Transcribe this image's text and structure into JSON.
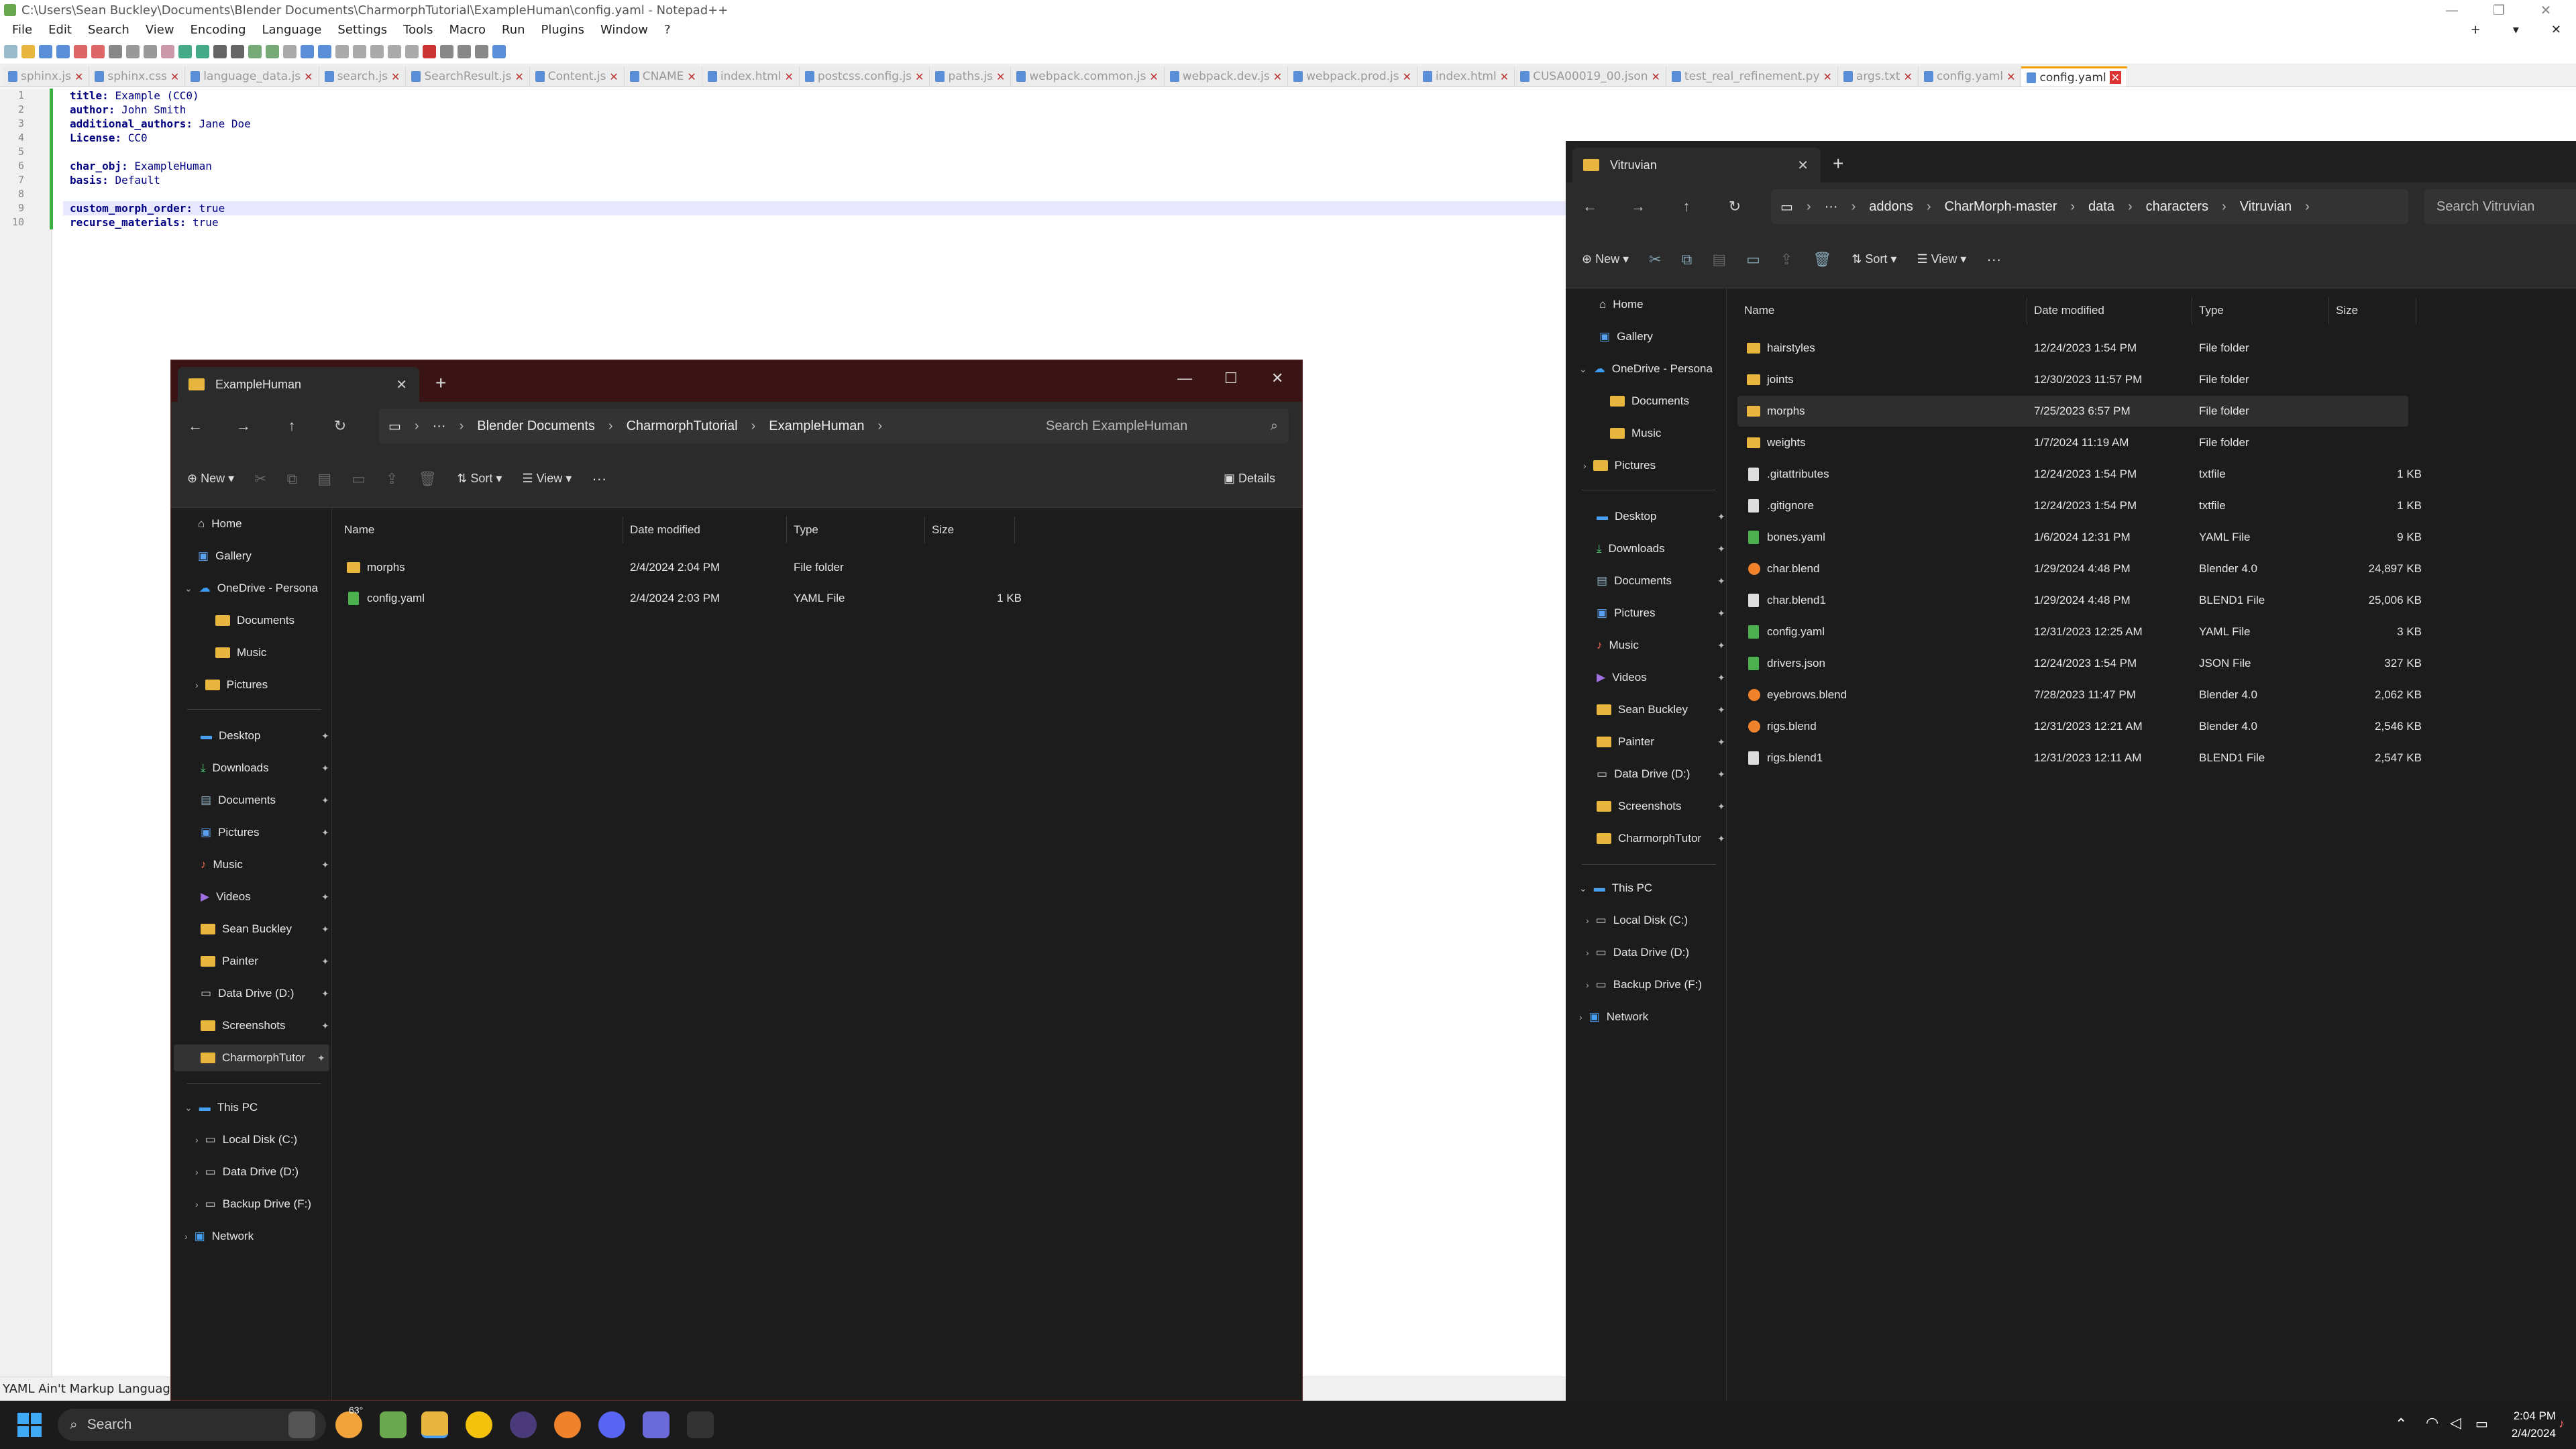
{
  "npp": {
    "title": "C:\\Users\\Sean Buckley\\Documents\\Blender Documents\\CharmorphTutorial\\ExampleHuman\\config.yaml - Notepad++",
    "menu": [
      "File",
      "Edit",
      "Search",
      "View",
      "Encoding",
      "Language",
      "Settings",
      "Tools",
      "Macro",
      "Run",
      "Plugins",
      "Window",
      "?"
    ],
    "menu_right": [
      "+",
      "▾",
      "✕"
    ],
    "tabs": [
      "sphinx.js",
      "sphinx.css",
      "language_data.js",
      "search.js",
      "SearchResult.js",
      "Content.js",
      "CNAME",
      "index.html",
      "postcss.config.js",
      "paths.js",
      "webpack.common.js",
      "webpack.dev.js",
      "webpack.prod.js",
      "index.html",
      "CUSA00019_00.json",
      "test_real_refinement.py",
      "args.txt",
      "config.yaml",
      "config.yaml"
    ],
    "line_numbers": [
      "1",
      "2",
      "3",
      "4",
      "5",
      "6",
      "7",
      "8",
      "9",
      "10"
    ],
    "lines": [
      {
        "key": "title",
        "val": " Example (CC0)"
      },
      {
        "key": "author",
        "val": " John Smith"
      },
      {
        "key": "additional_authors",
        "val": " Jane Doe"
      },
      {
        "key": "License",
        "val": " CC0"
      },
      {
        "key": "",
        "val": ""
      },
      {
        "key": "char_obj",
        "val": " ExampleHuman"
      },
      {
        "key": "basis",
        "val": " Default"
      },
      {
        "key": "",
        "val": ""
      },
      {
        "key": "custom_morph_order",
        "val": " true"
      },
      {
        "key": "recurse_materials",
        "val": " true"
      }
    ],
    "status": "YAML Ain't Markup Language"
  },
  "ex1": {
    "tab_title": "ExampleHuman",
    "breadcrumb": [
      "Blender Documents",
      "CharmorphTutorial",
      "ExampleHuman"
    ],
    "search_placeholder": "Search ExampleHuman",
    "cmd": {
      "new": "New",
      "sort": "Sort",
      "view": "View",
      "more": "···",
      "details": "Details"
    },
    "nav": {
      "top": [
        "Home",
        "Gallery"
      ],
      "onedrive": "OneDrive - Persona",
      "onedrive_items": [
        "Documents",
        "Music",
        "Pictures"
      ],
      "quick": [
        "Desktop",
        "Downloads",
        "Documents",
        "Pictures",
        "Music",
        "Videos",
        "Sean Buckley",
        "Painter",
        "Data Drive (D:)",
        "Screenshots",
        "CharmorphTutor"
      ],
      "pc": "This PC",
      "pc_items": [
        "Local Disk (C:)",
        "Data Drive (D:)",
        "Backup Drive (F:)"
      ],
      "network": "Network"
    },
    "columns": [
      "Name",
      "Date modified",
      "Type",
      "Size"
    ],
    "files": [
      {
        "name": "morphs",
        "date": "2/4/2024 2:04 PM",
        "type": "File folder",
        "size": "",
        "kind": "folder"
      },
      {
        "name": "config.yaml",
        "date": "2/4/2024 2:03 PM",
        "type": "YAML File",
        "size": "1 KB",
        "kind": "yaml"
      }
    ]
  },
  "ex2": {
    "tab_title": "Vitruvian",
    "breadcrumb": [
      "addons",
      "CharMorph-master",
      "data",
      "characters",
      "Vitruvian"
    ],
    "search_placeholder": "Search Vitruvian",
    "cmd": {
      "new": "New",
      "sort": "Sort",
      "view": "View",
      "more": "···"
    },
    "nav": {
      "top": [
        "Home",
        "Gallery"
      ],
      "onedrive": "OneDrive - Persona",
      "onedrive_items": [
        "Documents",
        "Music",
        "Pictures"
      ],
      "quick": [
        "Desktop",
        "Downloads",
        "Documents",
        "Pictures",
        "Music",
        "Videos",
        "Sean Buckley",
        "Painter",
        "Data Drive (D:)",
        "Screenshots",
        "CharmorphTutor"
      ],
      "pc": "This PC",
      "pc_items": [
        "Local Disk (C:)",
        "Data Drive (D:)",
        "Backup Drive (F:)"
      ],
      "network": "Network"
    },
    "columns": [
      "Name",
      "Date modified",
      "Type",
      "Size"
    ],
    "files": [
      {
        "name": "hairstyles",
        "date": "12/24/2023 1:54 PM",
        "type": "File folder",
        "size": "",
        "kind": "folder"
      },
      {
        "name": "joints",
        "date": "12/30/2023 11:57 PM",
        "type": "File folder",
        "size": "",
        "kind": "folder"
      },
      {
        "name": "morphs",
        "date": "7/25/2023 6:57 PM",
        "type": "File folder",
        "size": "",
        "kind": "folder"
      },
      {
        "name": "weights",
        "date": "1/7/2024 11:19 AM",
        "type": "File folder",
        "size": "",
        "kind": "folder"
      },
      {
        "name": ".gitattributes",
        "date": "12/24/2023 1:54 PM",
        "type": "txtfile",
        "size": "1 KB",
        "kind": "txt"
      },
      {
        "name": ".gitignore",
        "date": "12/24/2023 1:54 PM",
        "type": "txtfile",
        "size": "1 KB",
        "kind": "txt"
      },
      {
        "name": "bones.yaml",
        "date": "1/6/2024 12:31 PM",
        "type": "YAML File",
        "size": "9 KB",
        "kind": "yaml"
      },
      {
        "name": "char.blend",
        "date": "1/29/2024 4:48 PM",
        "type": "Blender 4.0",
        "size": "24,897 KB",
        "kind": "blend"
      },
      {
        "name": "char.blend1",
        "date": "1/29/2024 4:48 PM",
        "type": "BLEND1 File",
        "size": "25,006 KB",
        "kind": "txt"
      },
      {
        "name": "config.yaml",
        "date": "12/31/2023 12:25 AM",
        "type": "YAML File",
        "size": "3 KB",
        "kind": "yaml"
      },
      {
        "name": "drivers.json",
        "date": "12/24/2023 1:54 PM",
        "type": "JSON File",
        "size": "327 KB",
        "kind": "yaml"
      },
      {
        "name": "eyebrows.blend",
        "date": "7/28/2023 11:47 PM",
        "type": "Blender 4.0",
        "size": "2,062 KB",
        "kind": "blend"
      },
      {
        "name": "rigs.blend",
        "date": "12/31/2023 12:21 AM",
        "type": "Blender 4.0",
        "size": "2,546 KB",
        "kind": "blend"
      },
      {
        "name": "rigs.blend1",
        "date": "12/31/2023 12:11 AM",
        "type": "BLEND1 File",
        "size": "2,547 KB",
        "kind": "txt"
      }
    ]
  },
  "taskbar": {
    "search": "Search",
    "weather": "63°",
    "time": "2:04 PM",
    "date": "2/4/2024"
  },
  "colors": {
    "folder": "#e8b63e",
    "yaml": "#4caf50",
    "blend": "#f0822c",
    "txt": "#dddddd",
    "accent": "#f5a000"
  }
}
